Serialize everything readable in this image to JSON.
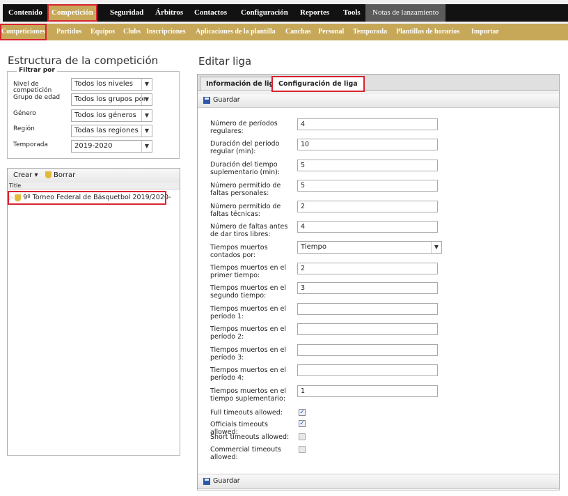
{
  "main_nav": [
    "Contenido",
    "Competición",
    "Seguridad",
    "Árbitros",
    "Contactos",
    "Configuración",
    "Reportes",
    "Tools",
    "Notas de lanzamiento"
  ],
  "sub_nav": [
    "Competiciones",
    "Partidos",
    "Equipos",
    "Clubs",
    "Inscripciones",
    "Aplicaciones de la plantilla",
    "Canchas",
    "Personal",
    "Temporada",
    "Plantillas de horarios",
    "Importar"
  ],
  "left": {
    "title": "Estructura de la competición",
    "filter_legend": "Filtrar por",
    "filters": [
      {
        "label": "Nivel de competición",
        "value": "Todos los niveles"
      },
      {
        "label": "Grupo de edad",
        "value": "Todos los grupos por"
      },
      {
        "label": "Género",
        "value": "Todos los géneros"
      },
      {
        "label": "Región",
        "value": "Todas las regiones"
      },
      {
        "label": "Temporada",
        "value": "2019-2020"
      }
    ],
    "tree": {
      "create": "Crear",
      "delete": "Borrar",
      "column": "Title",
      "row": "9º Torneo Federal de Básquetbol 2019/2020-"
    }
  },
  "right": {
    "title": "Editar liga",
    "tabs": [
      "Información de liga",
      "Configuración de liga"
    ],
    "save": "Guardar",
    "fields": [
      {
        "label": "Número de períodos regulares:",
        "value": "4"
      },
      {
        "label": "Duración del período regular (min):",
        "value": "10"
      },
      {
        "label": "Duración del tiempo suplementario (min):",
        "value": "5"
      },
      {
        "label": "Número permitido de faltas personales:",
        "value": "5"
      },
      {
        "label": "Número permitido de faltas técnicas:",
        "value": "2"
      },
      {
        "label": "Número de faltas antes de dar tiros libres:",
        "value": "4"
      },
      {
        "label": "Tiempos muertos contados por:",
        "value": "Tiempo"
      },
      {
        "label": "Tiempos muertos en el primer tiempo:",
        "value": "2"
      },
      {
        "label": "Tiempos muertos en el segundo tiempo:",
        "value": "3"
      },
      {
        "label": "Tiempos muertos en el período 1:",
        "value": ""
      },
      {
        "label": "Tiempos muertos en el período 2:",
        "value": ""
      },
      {
        "label": "Tiempos muertos en el período 3:",
        "value": ""
      },
      {
        "label": "Tiempos muertos en el período 4:",
        "value": ""
      },
      {
        "label": "Tiempos muertos en el tiempo suplementario:",
        "value": "1"
      }
    ],
    "checkboxes": [
      {
        "label": "Full timeouts allowed:",
        "checked": true
      },
      {
        "label": "Officials timeouts allowed:",
        "checked": true
      },
      {
        "label": "Short timeouts allowed:",
        "checked": false
      },
      {
        "label": "Commercial timeouts allowed:",
        "checked": false
      }
    ]
  },
  "colors": {
    "nav_bg": "#121212",
    "gold": "#c6a858",
    "highlight": "#d9232e"
  }
}
